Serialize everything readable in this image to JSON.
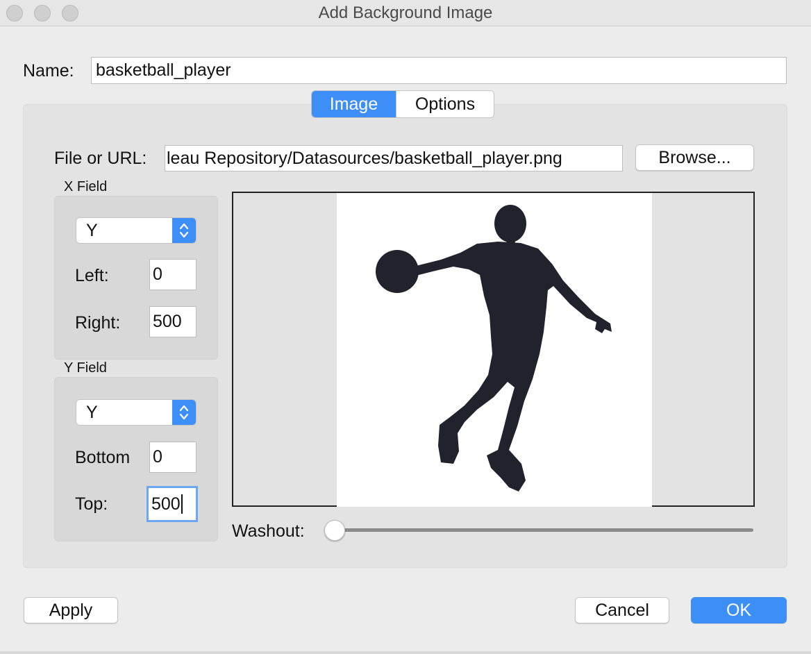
{
  "window": {
    "title": "Add Background Image",
    "controls": [
      "close",
      "minimize",
      "zoom"
    ]
  },
  "name_field": {
    "label": "Name:",
    "value": "basketball_player"
  },
  "tabs": [
    {
      "label": "Image",
      "active": true
    },
    {
      "label": "Options",
      "active": false
    }
  ],
  "file": {
    "label": "File or URL:",
    "value": "leau Repository/Datasources/basketball_player.png",
    "browse_label": "Browse..."
  },
  "x_field": {
    "heading": "X Field",
    "selected": "Y",
    "left_label": "Left:",
    "left_value": "0",
    "right_label": "Right:",
    "right_value": "500"
  },
  "y_field": {
    "heading": "Y Field",
    "selected": "Y",
    "bottom_label": "Bottom",
    "bottom_value": "0",
    "top_label": "Top:",
    "top_value": "500"
  },
  "preview": {
    "icon": "basketball-player-silhouette"
  },
  "washout": {
    "label": "Washout:",
    "value": 0
  },
  "buttons": {
    "apply": "Apply",
    "cancel": "Cancel",
    "ok": "OK"
  },
  "colors": {
    "accent": "#3d8ef7",
    "silhouette": "#22222c",
    "panel": "#e3e3e3"
  }
}
